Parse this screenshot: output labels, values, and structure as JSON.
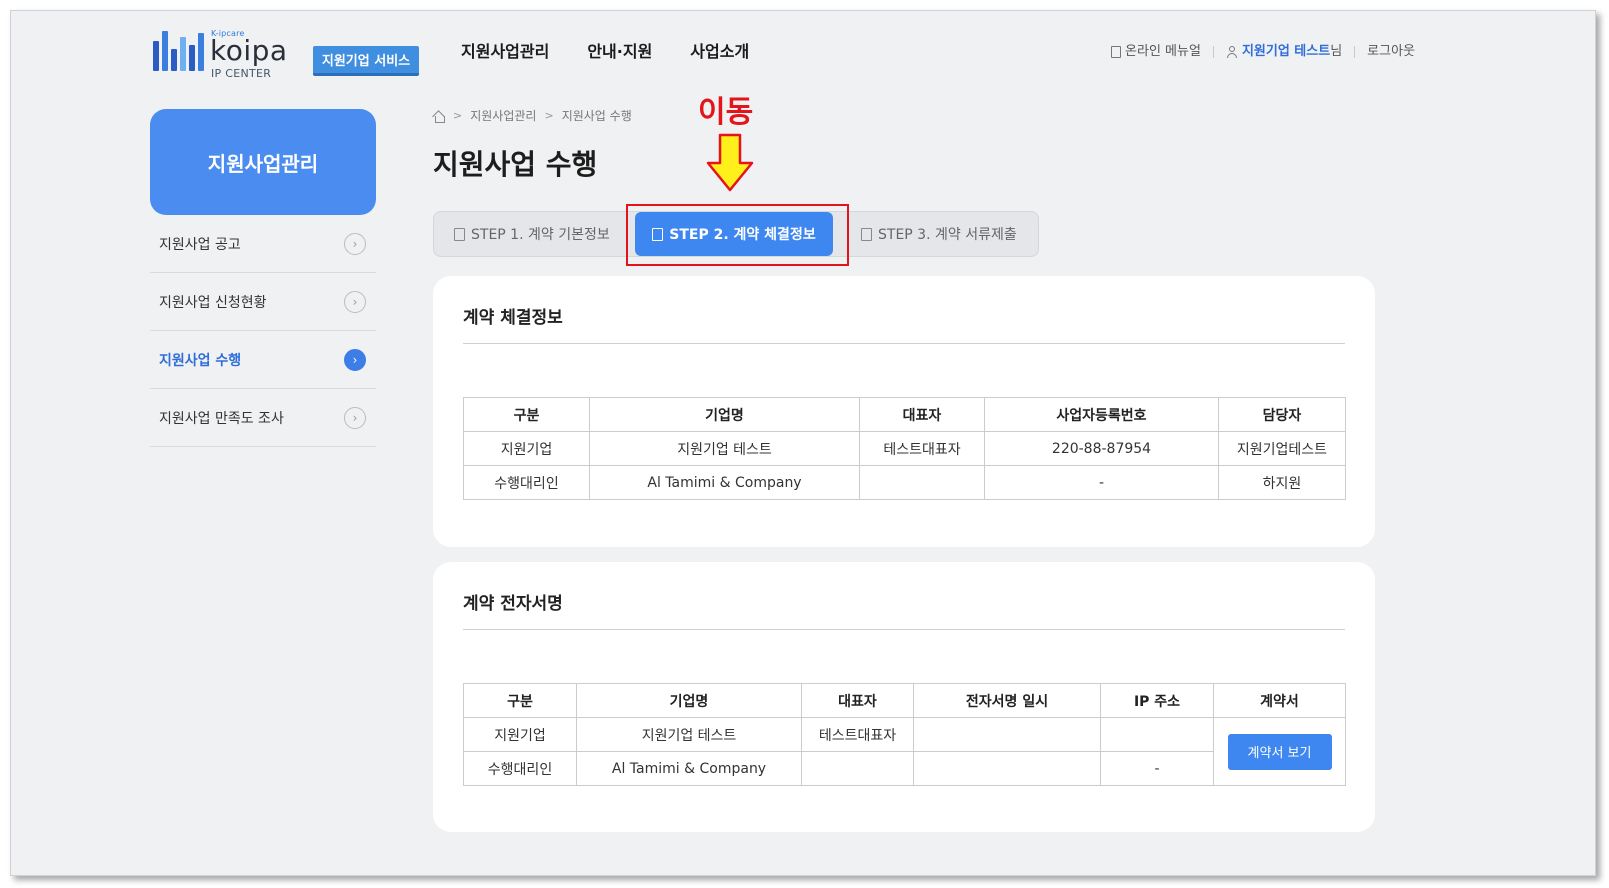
{
  "header": {
    "logo": {
      "tagline": "K-ipcare",
      "brand": "koipa",
      "sub": "IP CENTER"
    },
    "service_badge": "지원기업 서비스",
    "nav": [
      "지원사업관리",
      "안내·지원",
      "사업소개"
    ],
    "util": {
      "manual": "온라인 메뉴얼",
      "user_name": "지원기업 테스트",
      "user_suffix": "님",
      "logout": "로그아웃"
    }
  },
  "sidebar": {
    "title": "지원사업관리",
    "items": [
      {
        "label": "지원사업 공고",
        "active": false
      },
      {
        "label": "지원사업 신청현황",
        "active": false
      },
      {
        "label": "지원사업 수행",
        "active": true
      },
      {
        "label": "지원사업 만족도 조사",
        "active": false
      }
    ]
  },
  "breadcrumb": [
    "지원사업관리",
    "지원사업 수행"
  ],
  "page_title": "지원사업 수행",
  "annotation": {
    "label": "이동",
    "color": "#e4141b"
  },
  "steps": [
    {
      "label": "STEP 1. 계약 기본정보",
      "active": false
    },
    {
      "label": "STEP 2. 계약 체결정보",
      "active": true
    },
    {
      "label": "STEP 3. 계약 서류제출",
      "active": false
    }
  ],
  "contract_info": {
    "title": "계약 체결정보",
    "columns": [
      "구분",
      "기업명",
      "대표자",
      "사업자등록번호",
      "담당자"
    ],
    "rows": [
      [
        "지원기업",
        "지원기업 테스트",
        "테스트대표자",
        "220-88-87954",
        "지원기업테스트"
      ],
      [
        "수행대리인",
        "Al Tamimi & Company",
        "",
        "-",
        "하지원"
      ]
    ]
  },
  "esign": {
    "title": "계약 전자서명",
    "columns": [
      "구분",
      "기업명",
      "대표자",
      "전자서명 일시",
      "IP 주소",
      "계약서"
    ],
    "rows": [
      [
        "지원기업",
        "지원기업 테스트",
        "테스트대표자",
        "",
        ""
      ],
      [
        "수행대리인",
        "Al Tamimi & Company",
        "",
        "",
        "-"
      ]
    ],
    "view_button": "계약서 보기"
  },
  "colors": {
    "accent": "#3f87f0",
    "sidebar_head": "#4a8cf0",
    "badge": "#3f8ee0",
    "highlight": "#e4141b"
  }
}
